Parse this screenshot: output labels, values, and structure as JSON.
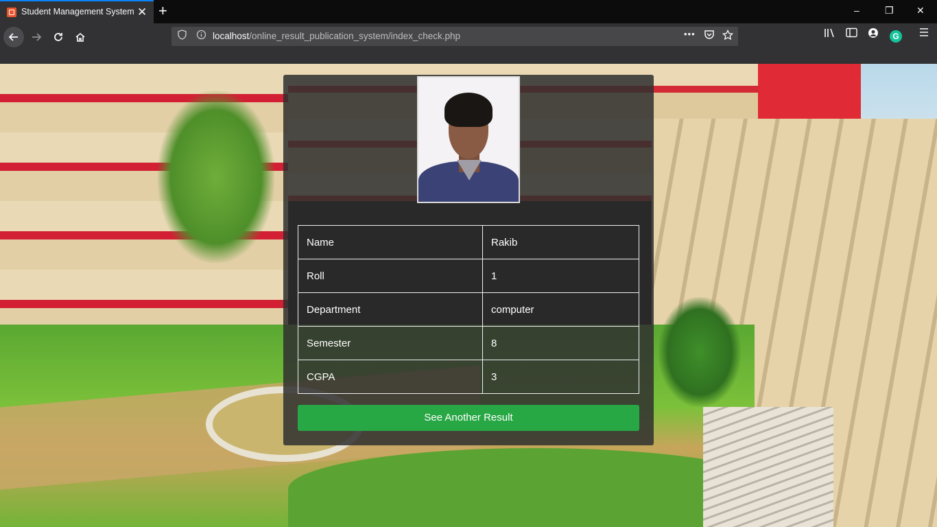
{
  "browser": {
    "tab_title": "Student Management System",
    "tab_close": "✕",
    "new_tab": "+",
    "url_host": "localhost",
    "url_path": "/online_result_publication_system/index_check.php",
    "more_label": "•••",
    "grammarly_label": "G"
  },
  "window_controls": {
    "minimize": "–",
    "restore": "❐",
    "close": "✕"
  },
  "profile": {
    "photo_alt": "Student photo"
  },
  "info_table": {
    "rows": [
      {
        "label": "Name",
        "value": "Rakib"
      },
      {
        "label": "Roll",
        "value": "1"
      },
      {
        "label": "Department",
        "value": "computer"
      },
      {
        "label": "Semester",
        "value": "8"
      },
      {
        "label": "CGPA",
        "value": "3"
      }
    ]
  },
  "actions": {
    "see_another": "See Another Result"
  },
  "colors": {
    "primary_button": "#28a745",
    "card_bg": "#303030",
    "tab_accent": "#0a84ff"
  },
  "icons": {
    "back": "arrow-left-icon",
    "forward": "arrow-right-icon",
    "reload": "reload-icon",
    "home": "home-icon",
    "shield": "shield-icon",
    "info": "info-icon",
    "pocket": "pocket-icon",
    "star": "star-icon",
    "library": "library-icon",
    "sidebar": "sidebar-icon",
    "account": "account-icon",
    "menu": "hamburger-menu-icon"
  }
}
